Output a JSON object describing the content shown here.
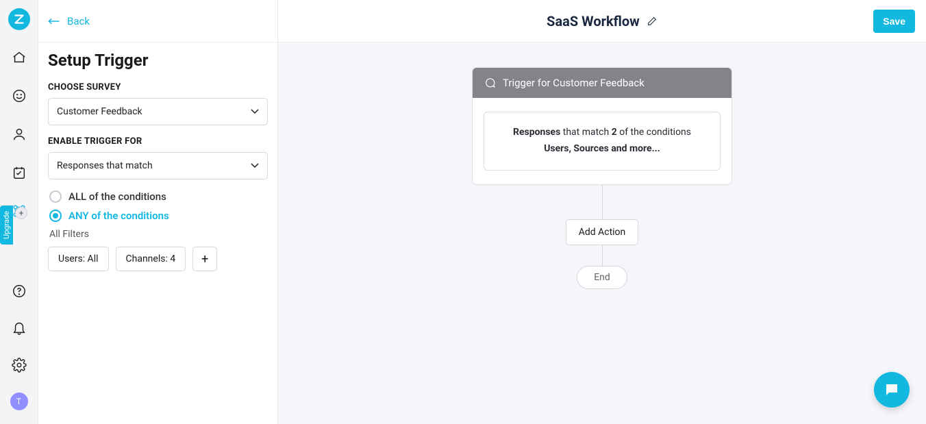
{
  "sidebar": {
    "upgrade": "Upgrade",
    "avatar": "T"
  },
  "panel": {
    "back": "Back",
    "title": "Setup Trigger",
    "choose_survey_label": "CHOOSE SURVEY",
    "survey_value": "Customer Feedback",
    "enable_trigger_label": "ENABLE TRIGGER FOR",
    "trigger_value": "Responses that match",
    "radio_all": "ALL of the conditions",
    "radio_any": "ANY of the conditions",
    "all_filters_label": "All Filters",
    "chip_users": "Users: All",
    "chip_channels": "Channels: 4",
    "chip_add": "+"
  },
  "header": {
    "workflow_title": "SaaS Workflow",
    "save": "Save"
  },
  "canvas": {
    "trigger_title": "Trigger for Customer Feedback",
    "summary_strong1": "Responses",
    "summary_mid1": " that match ",
    "summary_strong2": "2",
    "summary_mid2": " of the conditions",
    "summary_line2": "Users, Sources and more...",
    "add_action": "Add Action",
    "end": "End"
  }
}
